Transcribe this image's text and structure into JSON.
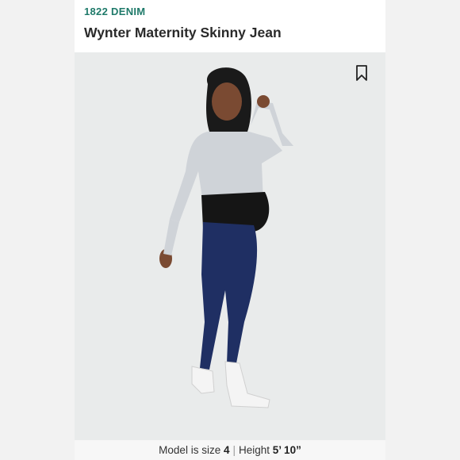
{
  "listing": {
    "brand": "1822 DENIM",
    "title": "Wynter Maternity Skinny Jean"
  },
  "colors": {
    "brand": "#1f7a6a",
    "photo_background": "#e9ebeb",
    "jeans": "#1f2f63",
    "top": "#cfd3d8",
    "waistband": "#151515"
  },
  "icons": {
    "bookmark": "bookmark-icon"
  },
  "model_info": {
    "size_label": "Model is size",
    "size_value": "4",
    "separator": "|",
    "height_label": "Height",
    "height_value": "5’ 10”"
  }
}
